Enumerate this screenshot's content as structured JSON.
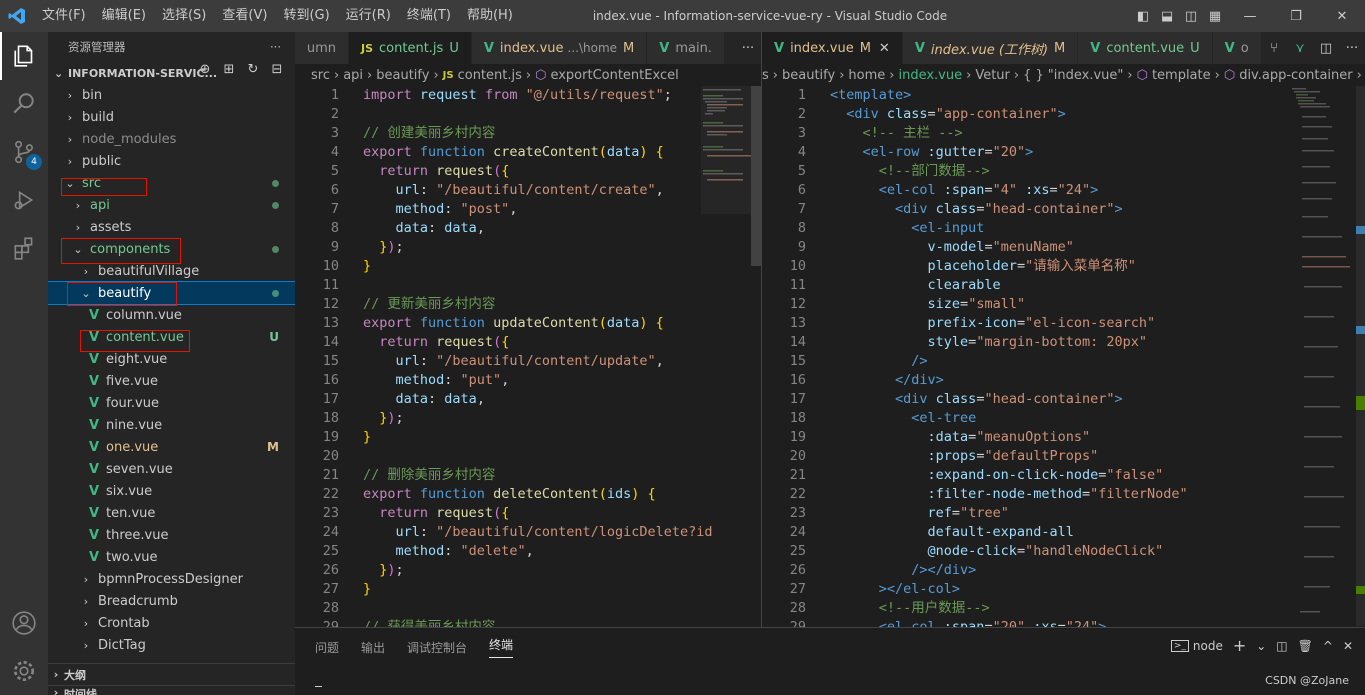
{
  "titlebar": {
    "menus": [
      "文件(F)",
      "编辑(E)",
      "选择(S)",
      "查看(V)",
      "转到(G)",
      "运行(R)",
      "终端(T)",
      "帮助(H)"
    ],
    "title": "index.vue - Information-service-vue-ry - Visual Studio Code"
  },
  "activity": {
    "scm_badge": "4"
  },
  "explorer": {
    "title": "资源管理器",
    "more": "···",
    "root": "INFORMATION-SERVIC...",
    "items": [
      {
        "label": "bin",
        "depth": 1,
        "chev": "›",
        "type": "folder"
      },
      {
        "label": "build",
        "depth": 1,
        "chev": "›",
        "type": "folder"
      },
      {
        "label": "node_modules",
        "depth": 1,
        "chev": "›",
        "type": "folder",
        "dim": true
      },
      {
        "label": "public",
        "depth": 1,
        "chev": "›",
        "type": "folder"
      },
      {
        "label": "src",
        "depth": 1,
        "chev": "⌄",
        "type": "folder",
        "status": "dot",
        "color": "#e2c08d"
      },
      {
        "label": "api",
        "depth": 2,
        "chev": "›",
        "type": "folder",
        "status": "dot",
        "color": "#e2c08d"
      },
      {
        "label": "assets",
        "depth": 2,
        "chev": "›",
        "type": "folder"
      },
      {
        "label": "components",
        "depth": 2,
        "chev": "⌄",
        "type": "folder",
        "status": "dot",
        "color": "#73c991"
      },
      {
        "label": "beautifulVillage",
        "depth": 3,
        "chev": "›",
        "type": "folder"
      },
      {
        "label": "beautify",
        "depth": 3,
        "chev": "⌄",
        "type": "folder",
        "status": "dot",
        "selected": true
      },
      {
        "label": "column.vue",
        "depth": 4,
        "type": "vue"
      },
      {
        "label": "content.vue",
        "depth": 4,
        "type": "vue",
        "status": "U",
        "color": "#73c991"
      },
      {
        "label": "eight.vue",
        "depth": 4,
        "type": "vue"
      },
      {
        "label": "five.vue",
        "depth": 4,
        "type": "vue"
      },
      {
        "label": "four.vue",
        "depth": 4,
        "type": "vue"
      },
      {
        "label": "nine.vue",
        "depth": 4,
        "type": "vue"
      },
      {
        "label": "one.vue",
        "depth": 4,
        "type": "vue",
        "status": "M",
        "color": "#e2c08d"
      },
      {
        "label": "seven.vue",
        "depth": 4,
        "type": "vue"
      },
      {
        "label": "six.vue",
        "depth": 4,
        "type": "vue"
      },
      {
        "label": "ten.vue",
        "depth": 4,
        "type": "vue"
      },
      {
        "label": "three.vue",
        "depth": 4,
        "type": "vue"
      },
      {
        "label": "two.vue",
        "depth": 4,
        "type": "vue"
      },
      {
        "label": "bpmnProcessDesigner",
        "depth": 3,
        "chev": "›",
        "type": "folder"
      },
      {
        "label": "Breadcrumb",
        "depth": 3,
        "chev": "›",
        "type": "folder"
      },
      {
        "label": "Crontab",
        "depth": 3,
        "chev": "›",
        "type": "folder"
      },
      {
        "label": "DictTag",
        "depth": 3,
        "chev": "›",
        "type": "folder"
      }
    ],
    "outline": "大纲",
    "timeline": "时间线"
  },
  "editor1": {
    "tabs": [
      {
        "label": "umn",
        "kind": "partial"
      },
      {
        "label": "content.js",
        "badge": "U",
        "kind": "js",
        "active": true
      },
      {
        "label": "index.vue",
        "sub": "...\\home",
        "badge": "M",
        "kind": "vue"
      },
      {
        "label": "main.",
        "kind": "vue"
      }
    ],
    "crumbs": [
      "src",
      "›",
      "api",
      "›",
      "beautify",
      "›",
      "JS",
      "content.js",
      "›",
      "⬡",
      "exportContentExcel"
    ],
    "lines": [
      [
        [
          "kw",
          "import "
        ],
        [
          "prop",
          "request "
        ],
        [
          "kw",
          "from "
        ],
        [
          "str",
          "\"@/utils/request\""
        ],
        [
          "",
          "; "
        ]
      ],
      [],
      [
        [
          "cm",
          "// 创建美丽乡村内容"
        ]
      ],
      [
        [
          "kw",
          "export "
        ],
        [
          "kw2",
          "function "
        ],
        [
          "fn",
          "createContent"
        ],
        [
          "brk",
          "("
        ],
        [
          "prop",
          "data"
        ],
        [
          "brk",
          ")"
        ],
        [
          "",
          " "
        ],
        [
          "brk",
          "{"
        ]
      ],
      [
        [
          "kw",
          "  return "
        ],
        [
          "fn",
          "request"
        ],
        [
          "brk2",
          "("
        ],
        [
          "brk",
          "{"
        ]
      ],
      [
        [
          "prop",
          "    url"
        ],
        [
          "",
          ": "
        ],
        [
          "str",
          "\"/beautiful/content/create\""
        ],
        [
          "",
          ","
        ]
      ],
      [
        [
          "prop",
          "    method"
        ],
        [
          "",
          ": "
        ],
        [
          "str",
          "\"post\""
        ],
        [
          "",
          ","
        ]
      ],
      [
        [
          "prop",
          "    data"
        ],
        [
          "",
          ": "
        ],
        [
          "prop",
          "data"
        ],
        [
          "",
          ","
        ]
      ],
      [
        [
          "brk",
          "  }"
        ],
        [
          "brk2",
          ")"
        ],
        [
          "",
          ";"
        ]
      ],
      [
        [
          "brk",
          "}"
        ]
      ],
      [],
      [
        [
          "cm",
          "// 更新美丽乡村内容"
        ]
      ],
      [
        [
          "kw",
          "export "
        ],
        [
          "kw2",
          "function "
        ],
        [
          "fn",
          "updateContent"
        ],
        [
          "brk",
          "("
        ],
        [
          "prop",
          "data"
        ],
        [
          "brk",
          ")"
        ],
        [
          "",
          " "
        ],
        [
          "brk",
          "{"
        ]
      ],
      [
        [
          "kw",
          "  return "
        ],
        [
          "fn",
          "request"
        ],
        [
          "brk2",
          "("
        ],
        [
          "brk",
          "{"
        ]
      ],
      [
        [
          "prop",
          "    url"
        ],
        [
          "",
          ": "
        ],
        [
          "str",
          "\"/beautiful/content/update\""
        ],
        [
          "",
          ","
        ]
      ],
      [
        [
          "prop",
          "    method"
        ],
        [
          "",
          ": "
        ],
        [
          "str",
          "\"put\""
        ],
        [
          "",
          ","
        ]
      ],
      [
        [
          "prop",
          "    data"
        ],
        [
          "",
          ": "
        ],
        [
          "prop",
          "data"
        ],
        [
          "",
          ","
        ]
      ],
      [
        [
          "brk",
          "  }"
        ],
        [
          "brk2",
          ")"
        ],
        [
          "",
          ";"
        ]
      ],
      [
        [
          "brk",
          "}"
        ]
      ],
      [],
      [
        [
          "cm",
          "// 删除美丽乡村内容"
        ]
      ],
      [
        [
          "kw",
          "export "
        ],
        [
          "kw2",
          "function "
        ],
        [
          "fn",
          "deleteContent"
        ],
        [
          "brk",
          "("
        ],
        [
          "prop",
          "ids"
        ],
        [
          "brk",
          ")"
        ],
        [
          "",
          " "
        ],
        [
          "brk",
          "{"
        ]
      ],
      [
        [
          "kw",
          "  return "
        ],
        [
          "fn",
          "request"
        ],
        [
          "brk2",
          "("
        ],
        [
          "brk",
          "{"
        ]
      ],
      [
        [
          "prop",
          "    url"
        ],
        [
          "",
          ": "
        ],
        [
          "str",
          "\"/beautiful/content/logicDelete?id"
        ]
      ],
      [
        [
          "prop",
          "    method"
        ],
        [
          "",
          ": "
        ],
        [
          "str",
          "\"delete\""
        ],
        [
          "",
          ","
        ]
      ],
      [
        [
          "brk",
          "  }"
        ],
        [
          "brk2",
          ")"
        ],
        [
          "",
          ";"
        ]
      ],
      [
        [
          "brk",
          "}"
        ]
      ],
      [],
      [
        [
          "cm",
          "// 获得美丽乡村内容"
        ]
      ]
    ]
  },
  "editor2": {
    "tabs": [
      {
        "label": "index.vue",
        "badge": "M",
        "kind": "vue",
        "active": true,
        "close": "✕"
      },
      {
        "label": "index.vue (工作树)",
        "badge": "M",
        "kind": "vue",
        "italic": true
      },
      {
        "label": "content.vue",
        "badge": "U",
        "kind": "vue"
      },
      {
        "label": "o",
        "kind": "vue"
      }
    ],
    "crumbs": [
      "s",
      "›",
      "beautify",
      "›",
      "home",
      "›",
      "index.vue",
      "›",
      "Vetur",
      "›",
      "{ }",
      "\"index.vue\"",
      "›",
      "⬡",
      "template",
      "›",
      "⬡",
      "div.app-container",
      "›"
    ],
    "lines": [
      [
        [
          "tag",
          "<template>"
        ]
      ],
      [
        [
          "tag",
          "  <div "
        ],
        [
          "attr",
          "class"
        ],
        [
          "",
          "="
        ],
        [
          "str",
          "\"app-container\""
        ],
        [
          "tag",
          ">"
        ]
      ],
      [
        [
          "cm",
          "    <!-- 主栏 -->"
        ]
      ],
      [
        [
          "tag",
          "    <el-row "
        ],
        [
          "attr",
          ":gutter"
        ],
        [
          "",
          "="
        ],
        [
          "str",
          "\"20\""
        ],
        [
          "tag",
          ">"
        ]
      ],
      [
        [
          "cm",
          "      <!--部门数据-->"
        ]
      ],
      [
        [
          "tag",
          "      <el-col "
        ],
        [
          "attr",
          ":span"
        ],
        [
          "",
          "="
        ],
        [
          "str",
          "\"4\" "
        ],
        [
          "attr",
          ":xs"
        ],
        [
          "",
          "="
        ],
        [
          "str",
          "\"24\""
        ],
        [
          "tag",
          ">"
        ]
      ],
      [
        [
          "tag",
          "        <div "
        ],
        [
          "attr",
          "class"
        ],
        [
          "",
          "="
        ],
        [
          "str",
          "\"head-container\""
        ],
        [
          "tag",
          ">"
        ]
      ],
      [
        [
          "tag",
          "          <el-input"
        ]
      ],
      [
        [
          "attr",
          "            v-model"
        ],
        [
          "",
          "="
        ],
        [
          "str",
          "\"menuName\""
        ]
      ],
      [
        [
          "attr",
          "            placeholder"
        ],
        [
          "",
          "="
        ],
        [
          "str",
          "\"请输入菜单名称\""
        ]
      ],
      [
        [
          "attr",
          "            clearable"
        ]
      ],
      [
        [
          "attr",
          "            size"
        ],
        [
          "",
          "="
        ],
        [
          "str",
          "\"small\""
        ]
      ],
      [
        [
          "attr",
          "            prefix-icon"
        ],
        [
          "",
          "="
        ],
        [
          "str",
          "\"el-icon-search\""
        ]
      ],
      [
        [
          "attr",
          "            style"
        ],
        [
          "",
          "="
        ],
        [
          "str",
          "\"margin-bottom: 20px\""
        ]
      ],
      [
        [
          "tag",
          "          />"
        ]
      ],
      [
        [
          "tag",
          "        </div>"
        ]
      ],
      [
        [
          "tag",
          "        <div "
        ],
        [
          "attr",
          "class"
        ],
        [
          "",
          "="
        ],
        [
          "str",
          "\"head-container\""
        ],
        [
          "tag",
          ">"
        ]
      ],
      [
        [
          "tag",
          "          <el-tree"
        ]
      ],
      [
        [
          "attr",
          "            :data"
        ],
        [
          "",
          "="
        ],
        [
          "str",
          "\"meanuOptions\""
        ]
      ],
      [
        [
          "attr",
          "            :props"
        ],
        [
          "",
          "="
        ],
        [
          "str",
          "\"defaultProps\""
        ]
      ],
      [
        [
          "attr",
          "            :expand-on-click-node"
        ],
        [
          "",
          "="
        ],
        [
          "str",
          "\"false\""
        ]
      ],
      [
        [
          "attr",
          "            :filter-node-method"
        ],
        [
          "",
          "="
        ],
        [
          "str",
          "\"filterNode\""
        ]
      ],
      [
        [
          "attr",
          "            ref"
        ],
        [
          "",
          "="
        ],
        [
          "str",
          "\"tree\""
        ]
      ],
      [
        [
          "attr",
          "            default-expand-all"
        ]
      ],
      [
        [
          "attr",
          "            @node-click"
        ],
        [
          "",
          "="
        ],
        [
          "str",
          "\"handleNodeClick\""
        ]
      ],
      [
        [
          "tag",
          "          /></div>"
        ]
      ],
      [
        [
          "tag",
          "      ></el-col>"
        ]
      ],
      [
        [
          "cm",
          "      <!--用户数据-->"
        ]
      ],
      [
        [
          "tag",
          "      <el-col "
        ],
        [
          "attr",
          ":span"
        ],
        [
          "",
          "="
        ],
        [
          "str",
          "\"20\" "
        ],
        [
          "attr",
          ":xs"
        ],
        [
          "",
          "="
        ],
        [
          "str",
          "\"24\""
        ],
        [
          "tag",
          ">"
        ]
      ]
    ]
  },
  "panel": {
    "tabs": [
      "问题",
      "输出",
      "调试控制台",
      "终端"
    ],
    "active": "终端",
    "terminal": "node",
    "actions": [
      "+",
      "⌄",
      "🗑",
      "^",
      "✕"
    ]
  },
  "watermark": "CSDN @ZoJane"
}
